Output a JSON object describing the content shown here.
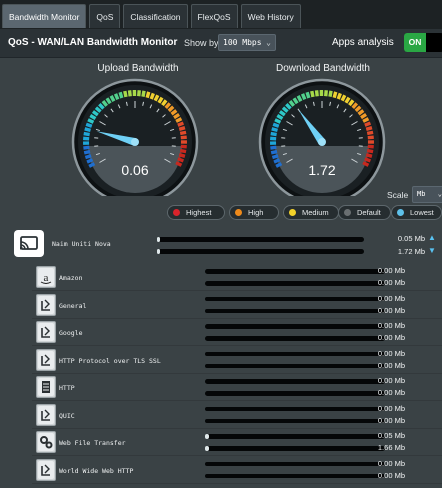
{
  "tabs": [
    "Bandwidth Monitor",
    "QoS",
    "Classification",
    "FlexQoS",
    "Web History"
  ],
  "header": {
    "title": "QoS - WAN/LAN Bandwidth Monitor",
    "show_by_label": "Show by",
    "show_by_value": "100 Mbps",
    "apps_label": "Apps analysis",
    "toggle_label": "ON"
  },
  "gauges": {
    "upload": {
      "title": "Upload Bandwidth",
      "value": "0.06",
      "needle_fraction": 0.19
    },
    "download": {
      "title": "Download Bandwidth",
      "value": "1.72",
      "needle_fraction": 0.35
    }
  },
  "scale": {
    "label": "Scale",
    "value": "Mb"
  },
  "legend": [
    {
      "label": "Highest",
      "color": "#d9232b"
    },
    {
      "label": "High",
      "color": "#ef8a1b"
    },
    {
      "label": "Medium",
      "color": "#f3d22a"
    },
    {
      "label": "Default",
      "color": "#6a6f71"
    },
    {
      "label": "Lowest",
      "color": "#5ec1ea"
    }
  ],
  "device": {
    "name": "Naim Uniti Nova",
    "upload": "0.05 Mb",
    "download": "1.72 Mb",
    "upload_fraction": 0.01,
    "download_fraction": 0.01
  },
  "apps": [
    {
      "name": "Amazon",
      "icon": "amazon-icon",
      "upload": "0.00 Mb",
      "download": "0.00 Mb",
      "upload_fraction": 0,
      "download_fraction": 0
    },
    {
      "name": "General",
      "icon": "app-generic-icon",
      "upload": "0.00 Mb",
      "download": "0.00 Mb",
      "upload_fraction": 0,
      "download_fraction": 0
    },
    {
      "name": "Google",
      "icon": "app-generic-icon",
      "upload": "0.00 Mb",
      "download": "0.00 Mb",
      "upload_fraction": 0,
      "download_fraction": 0
    },
    {
      "name": "HTTP Protocol over TLS SSL",
      "icon": "app-generic-icon",
      "upload": "0.00 Mb",
      "download": "0.00 Mb",
      "upload_fraction": 0,
      "download_fraction": 0
    },
    {
      "name": "HTTP",
      "icon": "document-icon",
      "upload": "0.00 Mb",
      "download": "0.00 Mb",
      "upload_fraction": 0,
      "download_fraction": 0
    },
    {
      "name": "QUIC",
      "icon": "app-generic-icon",
      "upload": "0.00 Mb",
      "download": "0.00 Mb",
      "upload_fraction": 0,
      "download_fraction": 0
    },
    {
      "name": "Web File Transfer",
      "icon": "gears-icon",
      "upload": "0.05 Mb",
      "download": "1.66 Mb",
      "upload_fraction": 0.01,
      "download_fraction": 0.01
    },
    {
      "name": "World Wide Web HTTP",
      "icon": "app-generic-icon",
      "upload": "0.00 Mb",
      "download": "0.00 Mb",
      "upload_fraction": 0,
      "download_fraction": 0
    }
  ]
}
